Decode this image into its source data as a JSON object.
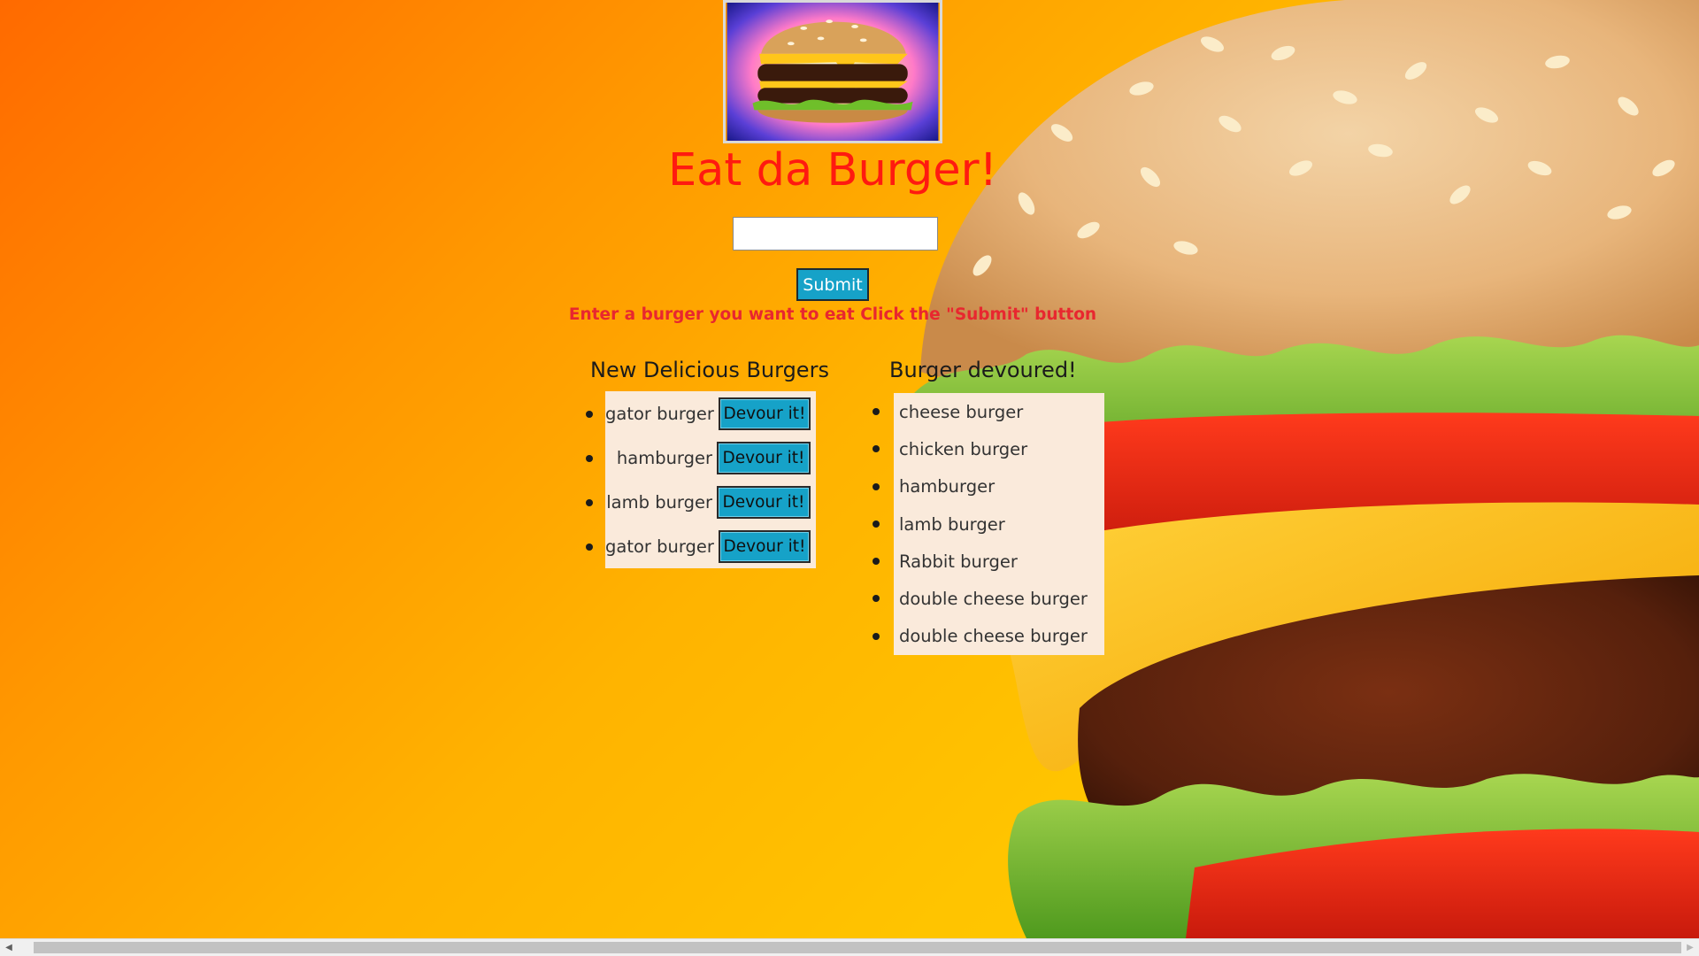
{
  "header": {
    "title": "Eat da Burger!",
    "logo_icon": "burger-thumbnail-icon"
  },
  "form": {
    "input_value": "",
    "input_placeholder": "",
    "submit_label": "Submit",
    "instructions": "Enter a burger you want to eat Click the \"Submit\" button"
  },
  "new_burgers": {
    "heading": "New Delicious Burgers",
    "items": [
      {
        "name": "gator burger",
        "button": "Devour it!"
      },
      {
        "name": "hamburger",
        "button": "Devour it!"
      },
      {
        "name": "lamb burger",
        "button": "Devour it!"
      },
      {
        "name": "gator burger",
        "button": "Devour it!"
      }
    ]
  },
  "devoured_burgers": {
    "heading": "Burger devoured!",
    "items": [
      "cheese burger",
      "chicken burger",
      "hamburger",
      "lamb burger",
      "Rabbit burger",
      "double cheese burger",
      "double cheese burger"
    ]
  },
  "colors": {
    "title": "#ff1a10",
    "instructions": "#e8272f",
    "button": "#16a2c8",
    "list_panel": "#faeadb",
    "background_start": "#ff6a00",
    "background_end": "#ffd000"
  },
  "scrollbar": {
    "left_arrow_icon": "chevron-left-icon",
    "right_arrow_icon": "chevron-right-icon"
  }
}
